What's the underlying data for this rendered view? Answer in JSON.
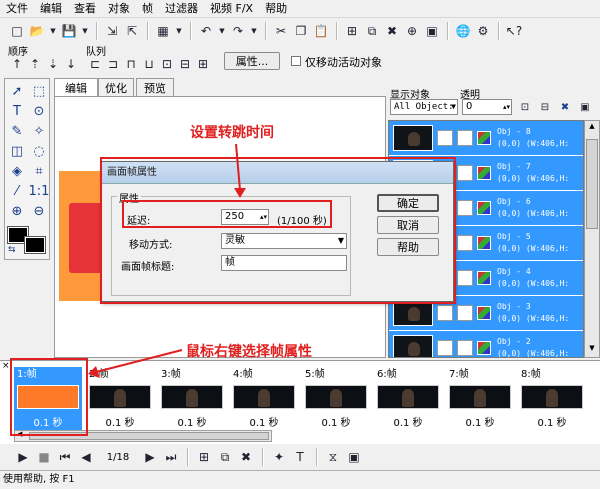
{
  "menu": [
    "文件",
    "编辑",
    "查看",
    "对象",
    "帧",
    "过滤器",
    "视频 F/X",
    "帮助"
  ],
  "toolbar2": {
    "order_label": "顺序",
    "queue_label": "队列",
    "properties_button": "属性...",
    "move_active_only": "仅移动活动对象"
  },
  "tabs": [
    "编辑",
    "优化",
    "预览"
  ],
  "right_panel": {
    "show_objects_label": "显示对象",
    "transparency_label": "透明",
    "filter_value": "All Object:",
    "transparency_value": "0",
    "objects": [
      {
        "name": "Obj - 8",
        "coords": "(0,0) (W:406,H:"
      },
      {
        "name": "Obj - 7",
        "coords": "(0,0) (W:406,H:"
      },
      {
        "name": "Obj - 6",
        "coords": "(0,0) (W:406,H:"
      },
      {
        "name": "Obj - 5",
        "coords": "(0,0) (W:406,H:"
      },
      {
        "name": "Obj - 4",
        "coords": "(0,0) (W:406,H:"
      },
      {
        "name": "Obj - 3",
        "coords": "(0,0) (W:406,H:"
      },
      {
        "name": "Obj - 2",
        "coords": "(0,0) (W:406,H:"
      }
    ]
  },
  "dialog": {
    "title": "画面帧属性",
    "group_label": "属性",
    "delay_label": "延迟:",
    "delay_value": "250",
    "delay_unit": "(1/100 秒)",
    "movement_label": "移动方式:",
    "movement_value": "灵敏",
    "title_label": "画面帧标题:",
    "title_value": "帧",
    "ok": "确定",
    "cancel": "取消",
    "help": "帮助"
  },
  "annotations": {
    "top": "设置转跳时间",
    "bottom": "鼠标右键选择帧属性"
  },
  "frames": [
    {
      "label": "1:帧",
      "delay": "0.1 秒"
    },
    {
      "label": "2:帧",
      "delay": "0.1 秒"
    },
    {
      "label": "3:帧",
      "delay": "0.1 秒"
    },
    {
      "label": "4:帧",
      "delay": "0.1 秒"
    },
    {
      "label": "5:帧",
      "delay": "0.1 秒"
    },
    {
      "label": "6:帧",
      "delay": "0.1 秒"
    },
    {
      "label": "7:帧",
      "delay": "0.1 秒"
    },
    {
      "label": "8:帧",
      "delay": "0.1 秒"
    }
  ],
  "playbar": {
    "counter": "1/18"
  },
  "status": "使用帮助, 按 F1"
}
